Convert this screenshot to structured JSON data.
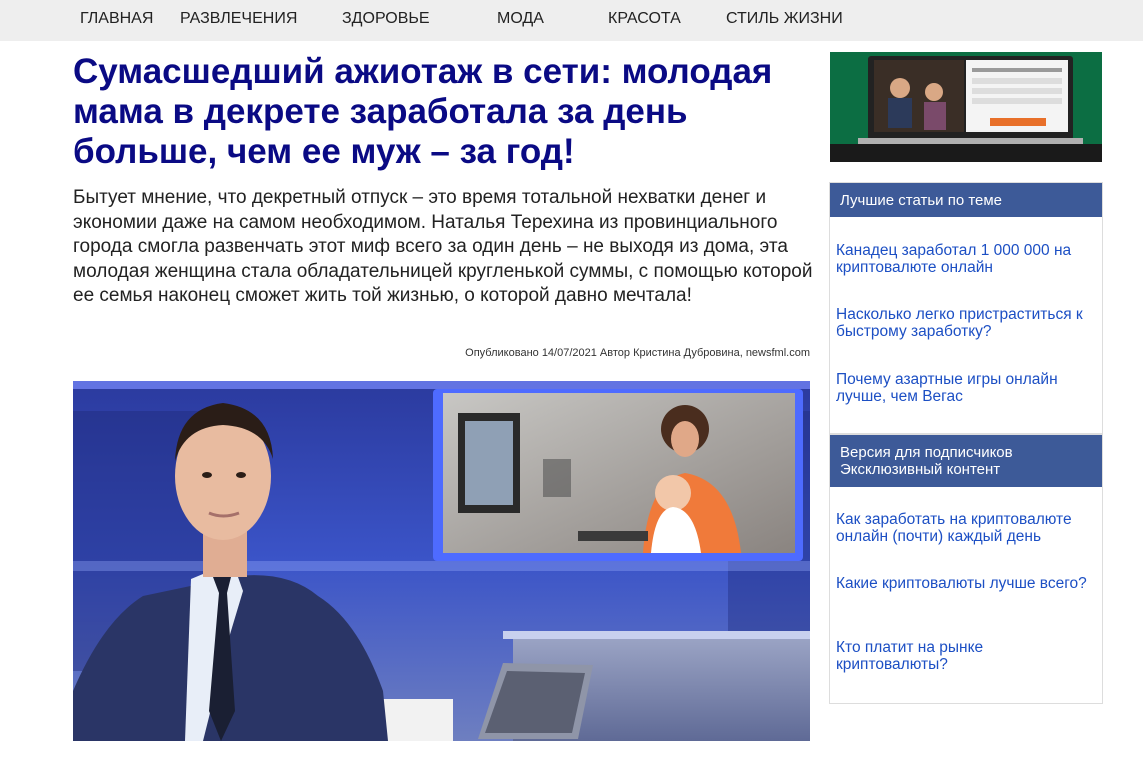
{
  "nav": {
    "items": [
      {
        "label": "ГЛАВНАЯ"
      },
      {
        "label": "РАЗВЛЕЧЕНИЯ"
      },
      {
        "label": "ЗДОРОВЬЕ"
      },
      {
        "label": "МОДА"
      },
      {
        "label": "КРАСОТА"
      },
      {
        "label": "СТИЛЬ ЖИЗНИ"
      }
    ]
  },
  "article": {
    "headline": "Сумасшедший ажиотаж в сети: молодая мама в декрете заработала за день больше, чем ее муж – за год!",
    "lead": "Бытует мнение, что декретный отпуск – это время тотальной нехватки денег и экономии даже на самом необходимом. Наталья Терехина из провинциального города смогла развенчать этот миф всего за один день – не выходя из дома, эта молодая женщина стала обладательницей кругленькой суммы, с помощью которой ее семья наконец сможет жить той жизнью, о которой давно мечтала!",
    "byline": "Опубликовано 14/07/2021 Автор Кристина Дубровина, newsfml.com"
  },
  "sidebar": {
    "box1": {
      "title": "Лучшие статьи по теме",
      "links": [
        {
          "label": "Канадец заработал 1 000 000 на криптовалюте онлайн"
        },
        {
          "label": "Насколько легко пристраститься к быстрому заработку?"
        },
        {
          "label": "Почему азартные игры онлайн лучше, чем Вегас"
        }
      ]
    },
    "box2": {
      "title_line1": "Версия для подписчиков",
      "title_line2": "Эксклюзивный контент",
      "links": [
        {
          "label": "Как заработать на криптовалюте онлайн (почти) каждый день"
        },
        {
          "label": "Какие криптовалюты лучше всего?"
        },
        {
          "label": "Кто платит на рынке криптовалюты?"
        }
      ]
    }
  },
  "colors": {
    "headline": "#0a0a84",
    "sidebar_header": "#3d5a98",
    "link": "#1c4fc4",
    "nav_bg": "#eeeeee"
  }
}
